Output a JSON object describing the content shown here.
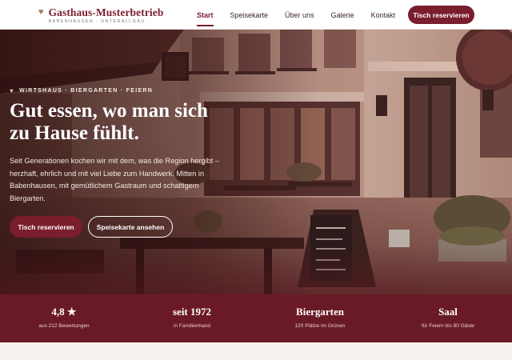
{
  "brand": {
    "name": "Gasthaus-Musterbetrieb",
    "subtitle": "BABENHAUSEN · UNTERALLGÄU",
    "icon": "heart-icon",
    "icon_color": "#a57a48"
  },
  "nav": {
    "items": [
      {
        "label": "Start",
        "active": true
      },
      {
        "label": "Speisekarte",
        "active": false
      },
      {
        "label": "Über uns",
        "active": false
      },
      {
        "label": "Galerie",
        "active": false
      },
      {
        "label": "Kontakt",
        "active": false
      }
    ],
    "cta_label": "Tisch reservieren"
  },
  "hero": {
    "kicker": "WIRTSHAUS · BIERGARTEN · FEIERN",
    "headline_line1": "Gut essen, wo man sich",
    "headline_line2": "zu Hause fühlt.",
    "lead": "Seit Generationen kochen wir mit dem, was die Region hergibt – herzhaft, ehrlich und mit viel Liebe zum Handwerk. Mitten in Babenhausen, mit gemütlichem Gastraum und schattigem Biergarten.",
    "primary_button": "Tisch reservieren",
    "secondary_button": "Speisekarte ansehen"
  },
  "stats": [
    {
      "value": "4,8 ★",
      "label": "aus 212 Bewertungen"
    },
    {
      "value": "seit 1972",
      "label": "in Familienhand"
    },
    {
      "value": "Biergarten",
      "label": "120 Plätze im Grünen"
    },
    {
      "value": "Saal",
      "label": "für Feiern bis 80 Gäste"
    }
  ],
  "colors": {
    "accent": "#7a1d2d",
    "stats_band": "#6a1a26",
    "background": "#f6f2ee"
  }
}
